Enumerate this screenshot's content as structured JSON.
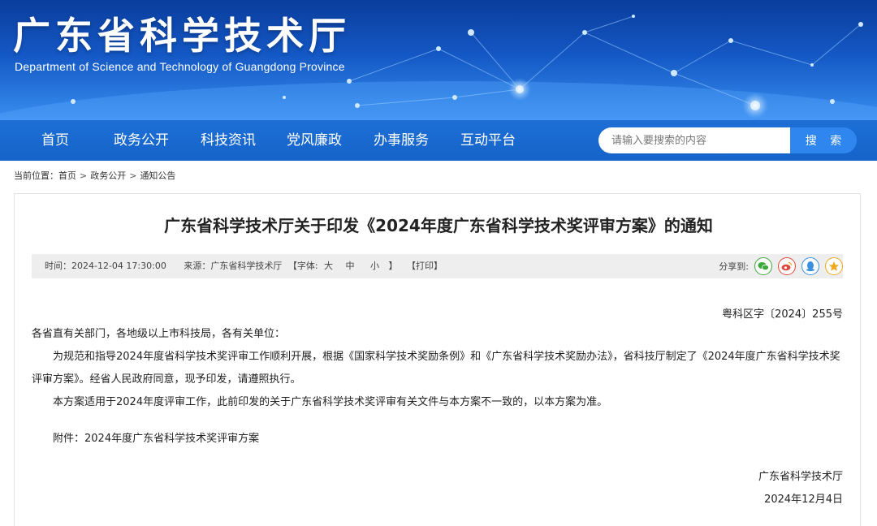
{
  "header": {
    "title": "广东省科学技术厅",
    "subtitle": "Department of Science and Technology of Guangdong Province"
  },
  "nav": {
    "items": [
      "首页",
      "政务公开",
      "科技资讯",
      "党风廉政",
      "办事服务",
      "互动平台"
    ],
    "search_placeholder": "请输入要搜索的内容",
    "search_button": "搜 索"
  },
  "breadcrumb": {
    "prefix": "当前位置：",
    "items": [
      "首页",
      "政务公开",
      "通知公告"
    ],
    "separator": ">"
  },
  "article": {
    "title": "广东省科学技术厅关于印发《2024年度广东省科学技术奖评审方案》的通知",
    "meta": {
      "time_label": "时间：2024-12-04 17:30:00",
      "source_label": "来源：广东省科学技术厅",
      "font_label": "【字体:",
      "font_large": "大",
      "font_medium": "中",
      "font_small": "小",
      "font_close": "】",
      "print": "【打印】",
      "share_label": "分享到:"
    },
    "share_icons": [
      {
        "icon": "wechat-icon",
        "color": "#3fa83a"
      },
      {
        "icon": "weibo-icon",
        "color": "#e0463a"
      },
      {
        "icon": "qq-icon",
        "color": "#3a8fe0"
      },
      {
        "icon": "qzone-icon",
        "color": "#f0a81c"
      }
    ],
    "doc_number": "粤科区字〔2024〕255号",
    "salutation": "各省直有关部门，各地级以上市科技局，各有关单位：",
    "paragraph1": "为规范和指导2024年度省科学技术奖评审工作顺利开展，根据《国家科学技术奖励条例》和《广东省科学技术奖励办法》，省科技厅制定了《2024年度广东省科学技术奖评审方案》。经省人民政府同意，现予印发，请遵照执行。",
    "paragraph2": "本方案适用于2024年度评审工作，此前印发的关于广东省科学技术奖评审有关文件与本方案不一致的，以本方案为准。",
    "attachment": "附件：2024年度广东省科学技术奖评审方案",
    "signature_org": "广东省科学技术厅",
    "signature_date": "2024年12月4日"
  }
}
